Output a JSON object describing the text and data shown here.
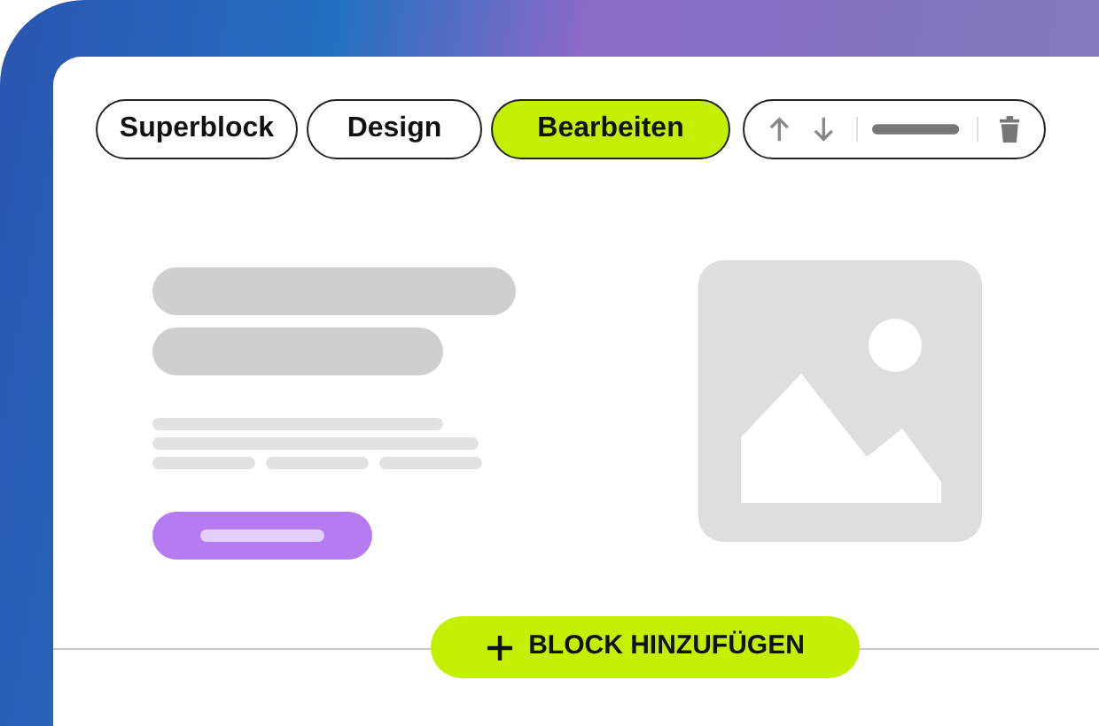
{
  "tabs": [
    {
      "label": "Superblock",
      "selected": false
    },
    {
      "label": "Design",
      "selected": false
    },
    {
      "label": "Bearbeiten",
      "selected": true
    }
  ],
  "add_button": {
    "label": "BLOCK HINZUFÜGEN"
  }
}
